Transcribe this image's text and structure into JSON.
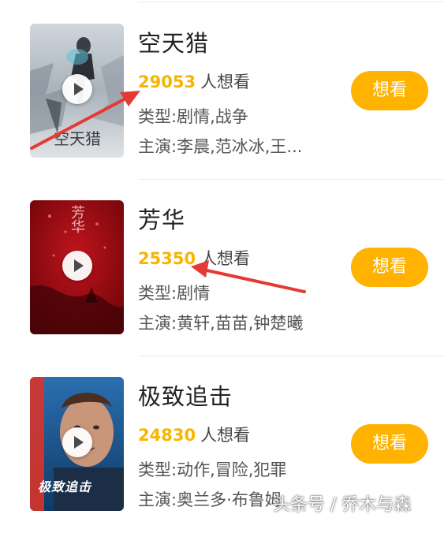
{
  "movies": [
    {
      "title": "空天猎",
      "want_count": "29053",
      "want_suffix": "人想看",
      "genre": "类型:剧情,战争",
      "cast": "主演:李晨,范冰冰,王...",
      "button": "想看",
      "poster_text": "空天猎"
    },
    {
      "title": "芳华",
      "want_count": "25350",
      "want_suffix": "人想看",
      "genre": "类型:剧情",
      "cast": "主演:黄轩,苗苗,钟楚曦",
      "button": "想看",
      "poster_text": "芳华"
    },
    {
      "title": "极致追击",
      "want_count": "24830",
      "want_suffix": "人想看",
      "genre": "类型:动作,冒险,犯罪",
      "cast": "主演:奥兰多·布鲁姆",
      "button": "想看",
      "poster_text": "极致追击"
    }
  ],
  "watermark": "头条号 / 乔木与森",
  "colors": {
    "accent": "#ffb300",
    "count": "#f7b500",
    "arrow": "#e53935"
  }
}
